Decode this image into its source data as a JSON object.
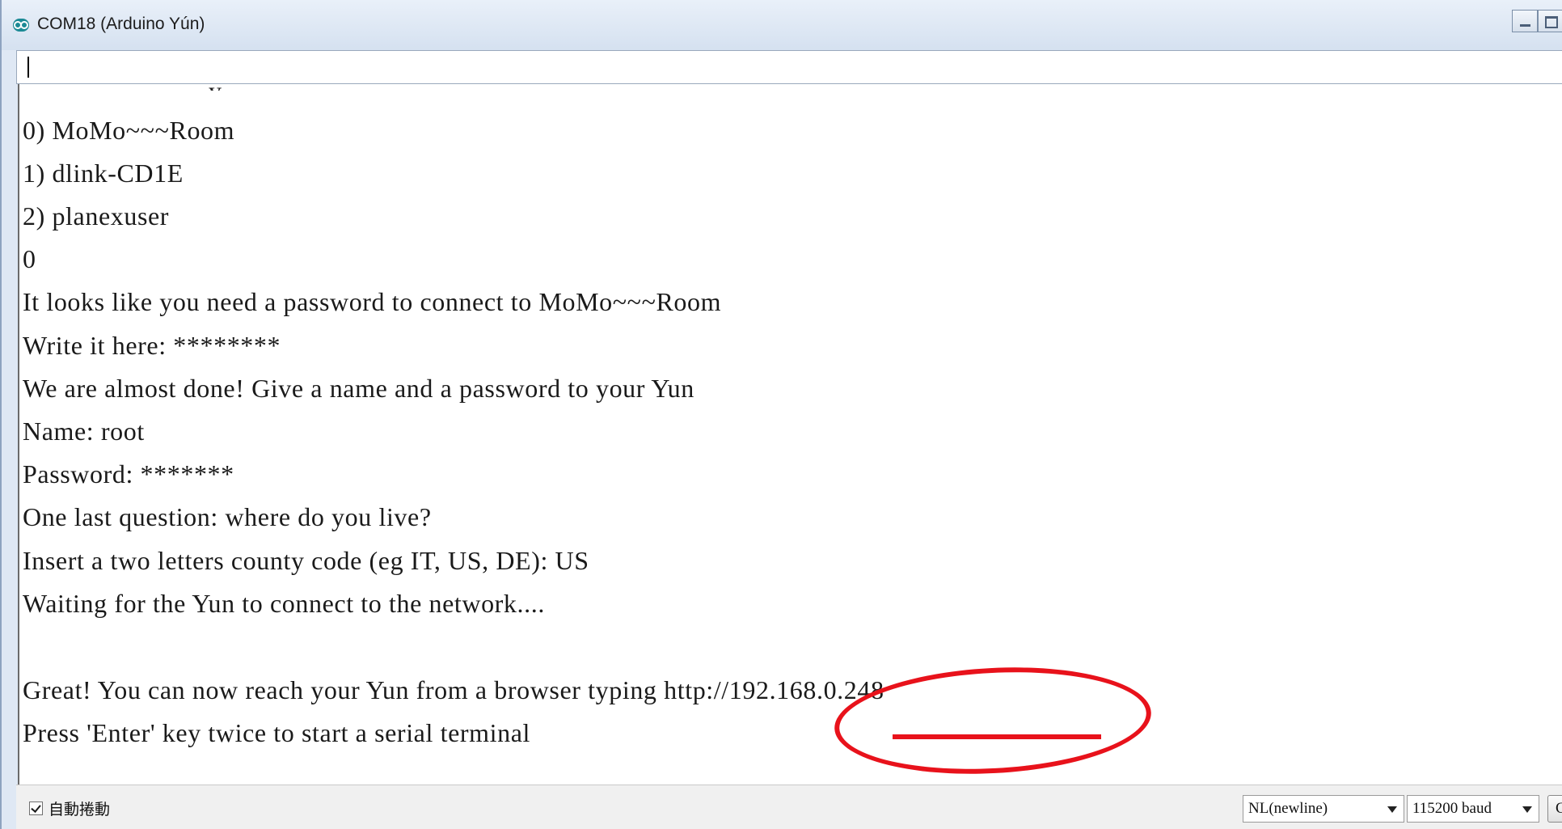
{
  "window": {
    "title": "COM18 (Arduino Yún)"
  },
  "input": {
    "value": ""
  },
  "output": {
    "lines": [
      "",
      "0) MoMo~~~Room",
      "1) dlink-CD1E",
      "2) planexuser",
      "0",
      "It looks like you need a password to connect to MoMo~~~Room",
      "Write it here: ********",
      "We are almost done! Give a name and a password to your Yun",
      "Name: root",
      "Password: *******",
      "One last question: where do you live?",
      "Insert a two letters county code (eg IT, US, DE): US",
      "Waiting for the Yun to connect to the network....",
      "",
      "Great! You can now reach your Yun from a browser typing http://192.168.0.248",
      "Press 'Enter' key twice to start a serial terminal"
    ]
  },
  "statusbar": {
    "autoscroll_label": "自動捲動",
    "autoscroll_checked": true,
    "line_ending": "NL(newline)",
    "baud_rate": "115200 baud",
    "clear_label": "Clear output"
  },
  "colors": {
    "annotation": "#e8121b",
    "app_icon": "#1c8a95"
  },
  "icons": [
    "arduino-app-icon",
    "minimize-icon",
    "maximize-icon",
    "dropdown-arrow-icon",
    "checkbox-checked-icon"
  ]
}
